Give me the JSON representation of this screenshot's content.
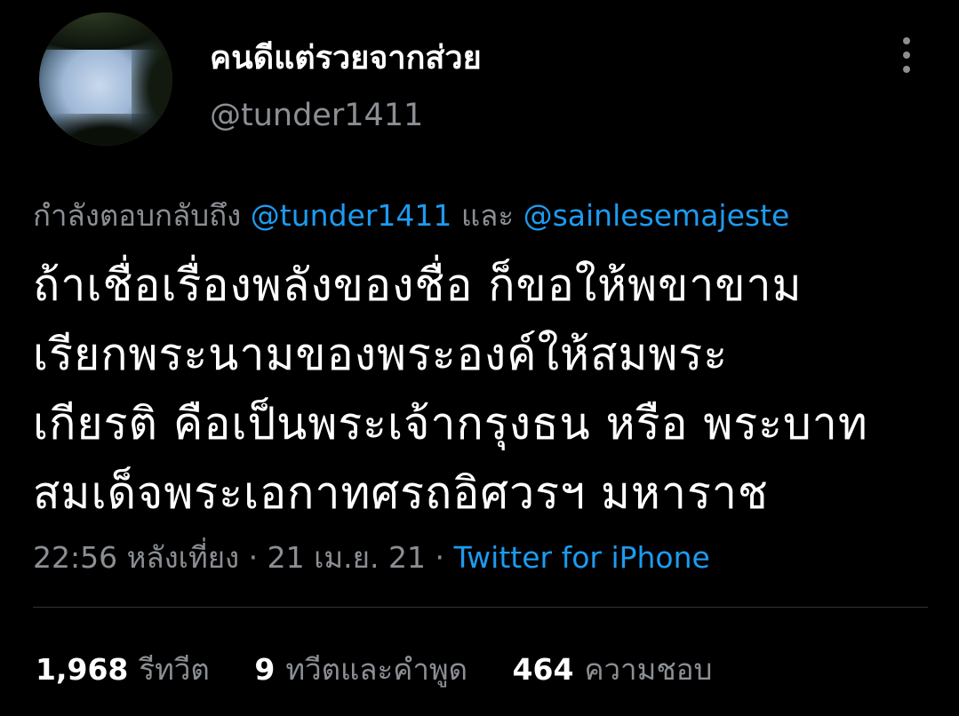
{
  "profile": {
    "display_name": "คนดีแต่รวยจากส่วย",
    "handle": "@tunder1411",
    "avatar": "avatar-sky-trees"
  },
  "header": {
    "more_icon": "more-vertical-icon"
  },
  "reply": {
    "prefix": "กำลังตอบกลับถึง",
    "mention_1": "@tunder1411",
    "joiner": "และ",
    "mention_2": "@sainlesemajeste"
  },
  "tweet": {
    "lines": [
      "ถ้าเชื่อเรื่องพลังของชื่อ ก็ขอให้พขาขาม",
      "เรียกพระนามของพระองค์ให้สมพระ",
      "เกียรติ คือเป็นพระเจ้ากรุงธน หรือ พระบาท",
      "สมเด็จพระเอกาทศรถอิศวรฯ มหาราช"
    ]
  },
  "meta": {
    "time": "22:56 หลังเที่ยง",
    "separator": "·",
    "date": "21 เม.ย. 21",
    "source": "Twitter for iPhone"
  },
  "stats": {
    "retweets_count": "1,968",
    "retweets_label": "รีทวีต",
    "quotes_count": "9",
    "quotes_label": "ทวีตและคำพูด",
    "likes_count": "464",
    "likes_label": "ความชอบ"
  },
  "colors": {
    "background": "#000000",
    "primary_text": "#ffffff",
    "secondary_text": "#8b8f94",
    "link": "#1d9bf0",
    "divider": "#2f3336"
  }
}
